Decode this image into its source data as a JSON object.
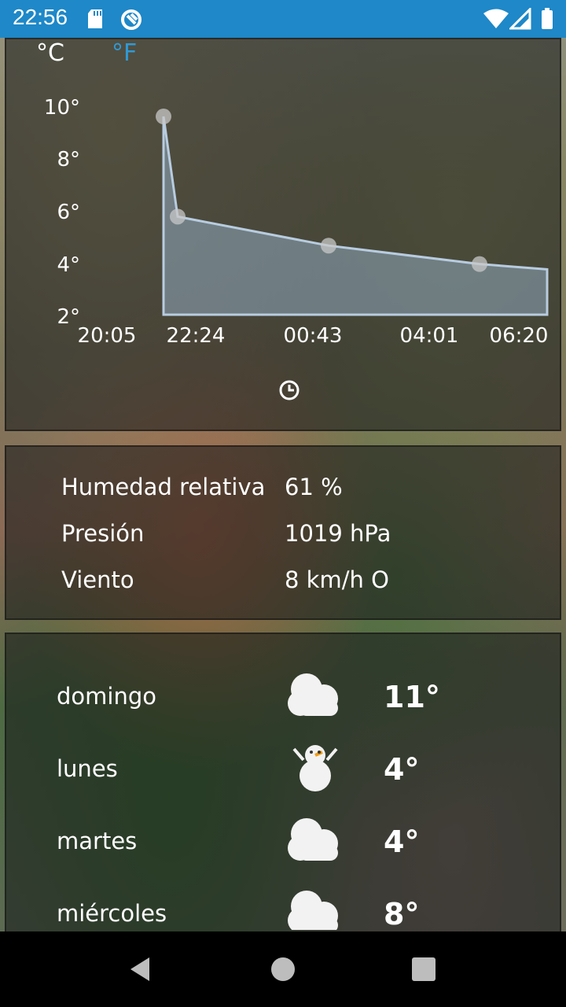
{
  "status_bar": {
    "time": "22:56",
    "icons": [
      "sd-card-icon",
      "sync-icon",
      "wifi-icon",
      "signal-icon",
      "battery-icon"
    ],
    "color": "#1e88c8"
  },
  "units": {
    "celsius": "°C",
    "fahrenheit": "°F",
    "selected": "celsius",
    "accent": "#2f9ad6"
  },
  "chart_data": {
    "type": "area",
    "y_tick_labels": [
      "10°",
      "8°",
      "6°",
      "4°",
      "2°"
    ],
    "x_tick_labels": [
      "20:05",
      "22:24",
      "00:43",
      "04:01",
      "06:20"
    ],
    "series": [
      {
        "x": [
          "20:05",
          "22:24",
          "00:43",
          "04:01",
          "06:20"
        ],
        "y": [
          9.7,
          5.9,
          4.8,
          4.1,
          3.9
        ]
      }
    ],
    "ylim": [
      2,
      10
    ]
  },
  "details": [
    {
      "label": "Humedad relativa",
      "value": "61 %"
    },
    {
      "label": "Presión",
      "value": "1019 hPa"
    },
    {
      "label": "Viento",
      "value": "8 km/h O"
    }
  ],
  "forecast": [
    {
      "day": "domingo",
      "icon": "cloud-icon",
      "temp": "11°"
    },
    {
      "day": "lunes",
      "icon": "snowman-icon",
      "temp": "4°"
    },
    {
      "day": "martes",
      "icon": "cloud-icon",
      "temp": "4°"
    },
    {
      "day": "miércoles",
      "icon": "cloud-icon",
      "temp": "8°"
    }
  ],
  "nav": [
    "back-icon",
    "home-icon",
    "recents-icon"
  ]
}
